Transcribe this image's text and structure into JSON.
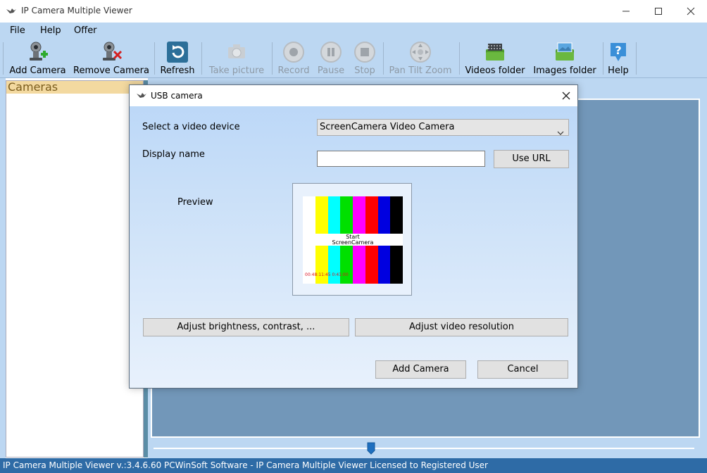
{
  "window": {
    "title": "IP Camera Multiple Viewer"
  },
  "menu": {
    "items": [
      "File",
      "Help",
      "Offer"
    ]
  },
  "toolbar": {
    "buttons": [
      {
        "label": "Add Camera",
        "icon": "add-camera-icon",
        "enabled": true
      },
      {
        "label": "Remove Camera",
        "icon": "remove-camera-icon",
        "enabled": true
      },
      {
        "label": "Refresh",
        "icon": "refresh-icon",
        "enabled": true
      },
      {
        "label": "Take picture",
        "icon": "take-picture-icon",
        "enabled": false
      },
      {
        "label": "Record",
        "icon": "record-icon",
        "enabled": false
      },
      {
        "label": "Pause",
        "icon": "pause-icon",
        "enabled": false
      },
      {
        "label": "Stop",
        "icon": "stop-icon",
        "enabled": false
      },
      {
        "label": "Pan Tilt Zoom",
        "icon": "pan-tilt-zoom-icon",
        "enabled": false
      },
      {
        "label": "Videos folder",
        "icon": "videos-folder-icon",
        "enabled": true
      },
      {
        "label": "Images folder",
        "icon": "images-folder-icon",
        "enabled": true
      },
      {
        "label": "Help",
        "icon": "help-icon",
        "enabled": true
      }
    ]
  },
  "left_panel": {
    "header": "Cameras"
  },
  "dialog": {
    "title": "USB camera",
    "video_device_label": "Select a video device",
    "video_device_value": "ScreenCamera Video Camera",
    "display_name_label": "Display name",
    "display_name_value": "",
    "use_url_button": "Use URL",
    "preview_label": "Preview",
    "preview_text_line1": "Start",
    "preview_text_line2": "ScreenCamera",
    "preview_timestamp": "00:48:11:45 0:41:00",
    "adjust_brightness_button": "Adjust brightness, contrast, ...",
    "adjust_resolution_button": "Adjust video resolution",
    "add_camera_button": "Add Camera",
    "cancel_button": "Cancel"
  },
  "status_bar": {
    "text": "IP Camera Multiple Viewer v.:3.4.6.60 PCWinSoft Software - IP Camera Multiple Viewer Licensed to Registered User"
  },
  "colors": {
    "menu_bg": "#bcd7f2",
    "video_pane": "#7297b9",
    "status_bg": "#2e6ba6",
    "cameras_header_bg": "#f3d9a0",
    "test_bars": [
      "#ffffff",
      "#ffff00",
      "#00ffff",
      "#00ff00",
      "#ff00ff",
      "#ff0000",
      "#0000ff",
      "#000000"
    ]
  }
}
